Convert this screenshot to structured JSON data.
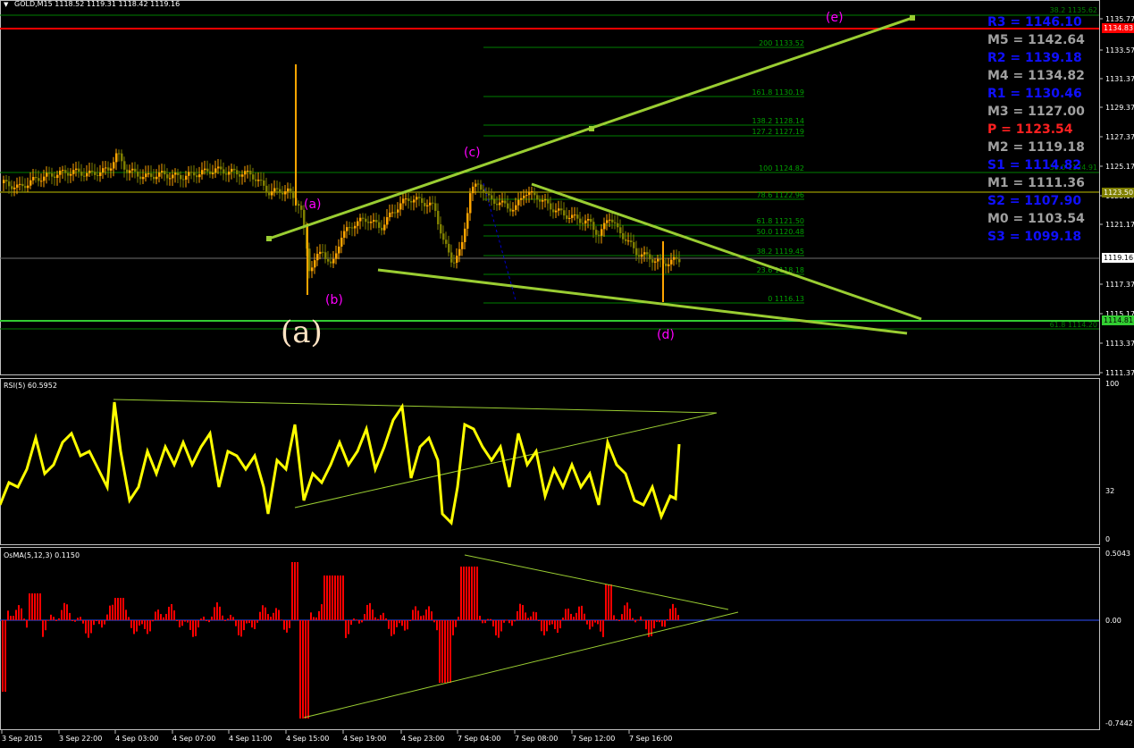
{
  "main_panel": {
    "header": "GOLD,M15  1118.52 1119.31 1118.42 1119.16",
    "symbol_arrow": "▼",
    "price_ticks": [
      "1135.77",
      "1133.57",
      "1131.37",
      "1129.37",
      "1127.37",
      "1125.17",
      "1123.17",
      "1121.17",
      "1119.16",
      "1117.37",
      "1115.17",
      "1113.37",
      "1111.37"
    ],
    "current_price_tag": "1119.16",
    "tags": {
      "resistance": "1134.83",
      "pivot": "1123.50",
      "support": "1114.81"
    },
    "wave_labels": {
      "a": "(a)",
      "b": "(b)",
      "c": "(c)",
      "d": "(d)",
      "e": "(e)",
      "big_a": "(a)"
    },
    "fib_levels": [
      {
        "label": "200 1133.52"
      },
      {
        "label": "161.8 1130.19"
      },
      {
        "label": "138.2 1128.14"
      },
      {
        "label": "127.2 1127.19"
      },
      {
        "label": "100 1124.82"
      },
      {
        "label": "78.6 1122.96"
      },
      {
        "label": "61.8 1121.50"
      },
      {
        "label": "50.0 1120.48"
      },
      {
        "label": "38.2 1119.45"
      },
      {
        "label": "23.6 1118.18"
      },
      {
        "label": "0 1116.13"
      }
    ],
    "fib_extra": [
      "38.2 1135.62",
      "50.0 1124.91",
      "61.8 1114.20"
    ],
    "pivots": [
      {
        "label": "R3 = 1146.10",
        "color": "#1010ff"
      },
      {
        "label": "M5 = 1142.64",
        "color": "#a0a0a0"
      },
      {
        "label": "R2 = 1139.18",
        "color": "#1010ff"
      },
      {
        "label": "M4 = 1134.82",
        "color": "#a0a0a0"
      },
      {
        "label": "R1 = 1130.46",
        "color": "#1010ff"
      },
      {
        "label": "M3 = 1127.00",
        "color": "#a0a0a0"
      },
      {
        "label": "P   = 1123.54",
        "color": "#ff2020"
      },
      {
        "label": "M2 = 1119.18",
        "color": "#a0a0a0"
      },
      {
        "label": "S1 = 1114.82",
        "color": "#1010ff"
      },
      {
        "label": "M1 = 1111.36",
        "color": "#a0a0a0"
      },
      {
        "label": "S2 = 1107.90",
        "color": "#1010ff"
      },
      {
        "label": "M0 = 1103.54",
        "color": "#a0a0a0"
      },
      {
        "label": "S3 = 1099.18",
        "color": "#1010ff"
      }
    ]
  },
  "rsi_panel": {
    "header": "RSI(5) 60.5952",
    "ticks": [
      "100",
      "32",
      "0"
    ]
  },
  "osma_panel": {
    "header": "OsMA(5,12,3) 0.1150",
    "ticks": [
      "0.5043",
      "0.00",
      "-0.7442"
    ]
  },
  "time_axis": [
    "3 Sep 2015",
    "3 Sep 22:00",
    "4 Sep 03:00",
    "4 Sep 07:00",
    "4 Sep 11:00",
    "4 Sep 15:00",
    "4 Sep 19:00",
    "4 Sep 23:00",
    "7 Sep 04:00",
    "7 Sep 08:00",
    "7 Sep 12:00",
    "7 Sep 16:00"
  ],
  "colors": {
    "candle_up": "#ffa500",
    "candle_down": "#808000",
    "trendline": "#9acd32",
    "rsi": "#ffff00",
    "osma": "#ff0000",
    "grid_axis": "#c0c0c0"
  }
}
